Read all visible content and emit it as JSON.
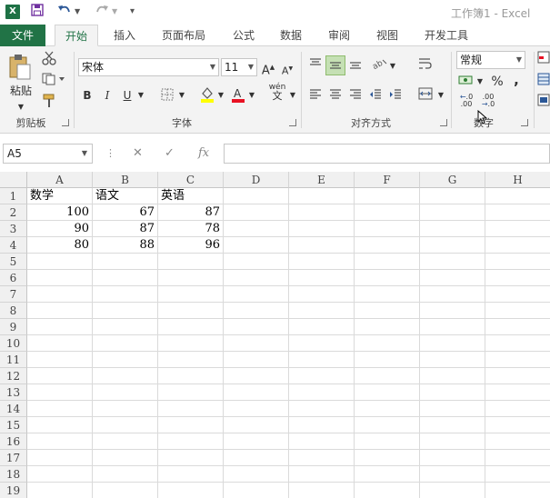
{
  "window": {
    "title": "工作簿1 - Excel",
    "app_icon": "excel-logo",
    "app_icon_text": "X"
  },
  "quick_access": {
    "save": "save-icon",
    "undo": "undo-icon",
    "redo": "redo-icon",
    "customize": "customize-icon"
  },
  "tabs": [
    "文件",
    "开始",
    "插入",
    "页面布局",
    "公式",
    "数据",
    "审阅",
    "视图",
    "开发工具"
  ],
  "active_tab": "开始",
  "ribbon": {
    "clipboard": {
      "paste_label": "粘贴",
      "group_label": "剪贴板"
    },
    "font": {
      "name": "宋体",
      "size": "11",
      "bold": "B",
      "italic": "I",
      "underline": "U",
      "phonetic": "wén",
      "group_label": "字体",
      "font_color": "#e81123",
      "fill_color": "#ffff00"
    },
    "alignment": {
      "group_label": "对齐方式"
    },
    "number": {
      "format": "常规",
      "percent": "%",
      "comma": ",",
      "group_label": "数字"
    }
  },
  "formula_bar": {
    "name_box": "A5",
    "cancel": "✕",
    "enter": "✓",
    "fx": "fx",
    "value": ""
  },
  "columns": [
    "A",
    "B",
    "C",
    "D",
    "E",
    "F",
    "G",
    "H"
  ],
  "rows": [
    "1",
    "2",
    "3",
    "4",
    "5",
    "6",
    "7",
    "8",
    "9",
    "10",
    "11",
    "12",
    "13",
    "14",
    "15",
    "16",
    "17",
    "18",
    "19"
  ],
  "cells": {
    "A1": "数学",
    "B1": "语文",
    "C1": "英语",
    "A2": "100",
    "B2": "67",
    "C2": "87",
    "A3": "90",
    "B3": "87",
    "C3": "78",
    "A4": "80",
    "B4": "88",
    "C4": "96"
  },
  "selected_cell": "A5",
  "accent": "#217346"
}
